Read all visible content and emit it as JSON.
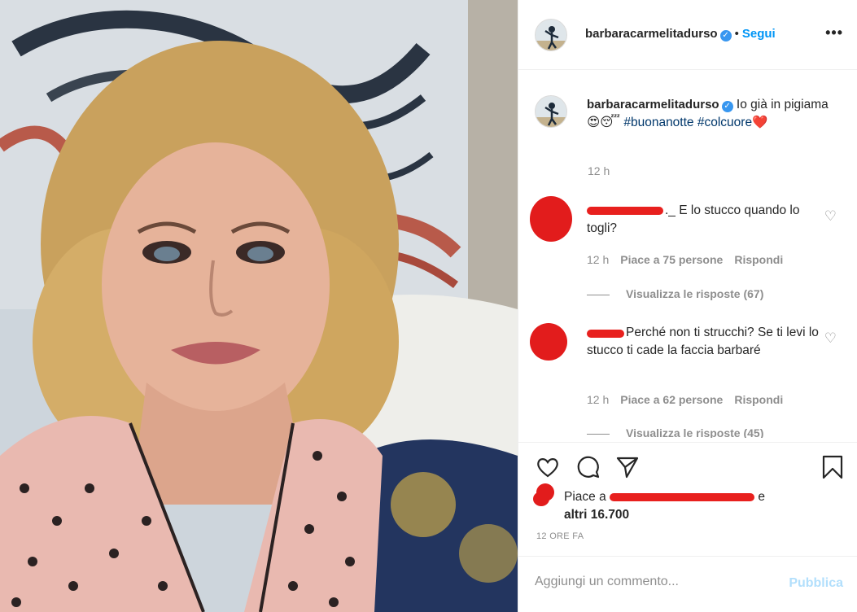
{
  "post": {
    "username": "barbaracarmelitadurso",
    "verified_icon": "verified-badge-icon",
    "separator": "•",
    "follow_label": "Segui",
    "more_label": "•••"
  },
  "caption": {
    "username": "barbaracarmelitadurso",
    "text_main": "Io già in pigiama",
    "emojis": "😍😴",
    "hashtag1": "#buonanotte",
    "hashtag2": "#colcuore",
    "heart_emoji": "❤️",
    "time": "12 h"
  },
  "comments": [
    {
      "username_suffix": "._",
      "text": "E lo stucco quando lo togli?",
      "time": "12 h",
      "likes": "Piace a 75 persone",
      "reply": "Rispondi",
      "view_replies": "Visualizza le risposte (67)"
    },
    {
      "text": "Perché non ti strucchi? Se ti levi lo stucco ti cade la faccia barbaré",
      "time": "12 h",
      "likes": "Piace a 62 persone",
      "reply": "Rispondi",
      "view_replies": "Visualizza le risposte (45)"
    }
  ],
  "likes": {
    "prefix": "Piace a",
    "and": "e",
    "others": "altri 16.700"
  },
  "timestamp": "12 ORE FA",
  "add_comment": {
    "placeholder": "Aggiungi un commento...",
    "publish": "Pubblica"
  },
  "colors": {
    "accent": "#0095f6",
    "redaction": "#e21c1c",
    "muted": "#8e8e8e"
  }
}
